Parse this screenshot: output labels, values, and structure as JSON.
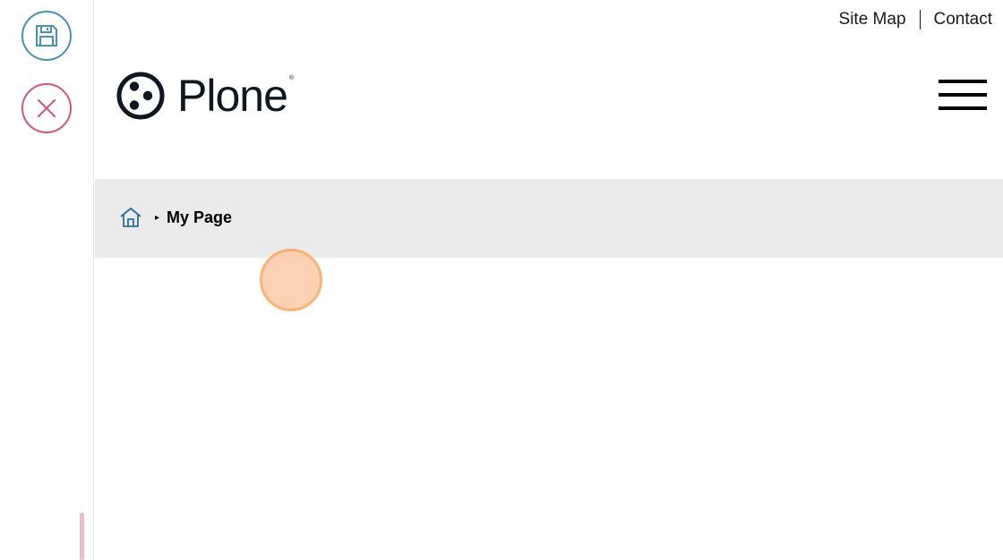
{
  "toolbar": {
    "save": {
      "icon": "save-icon",
      "color": "#4a90b0"
    },
    "cancel": {
      "icon": "close-icon",
      "color": "#d5527e"
    },
    "handle_color": "#f2b8d0"
  },
  "header": {
    "top_links": [
      "Site Map",
      "Contact"
    ],
    "logo": {
      "text": "Plone",
      "registered": "®",
      "color": "#0f1820"
    },
    "menu_icon": "hamburger-icon"
  },
  "breadcrumbs": {
    "home_icon": "home-icon",
    "home_color": "#2c6fa0",
    "separator": "▸",
    "current": "My Page"
  },
  "click_marker": {
    "fill": "#fdc9a6",
    "border": "#f6a85e"
  }
}
